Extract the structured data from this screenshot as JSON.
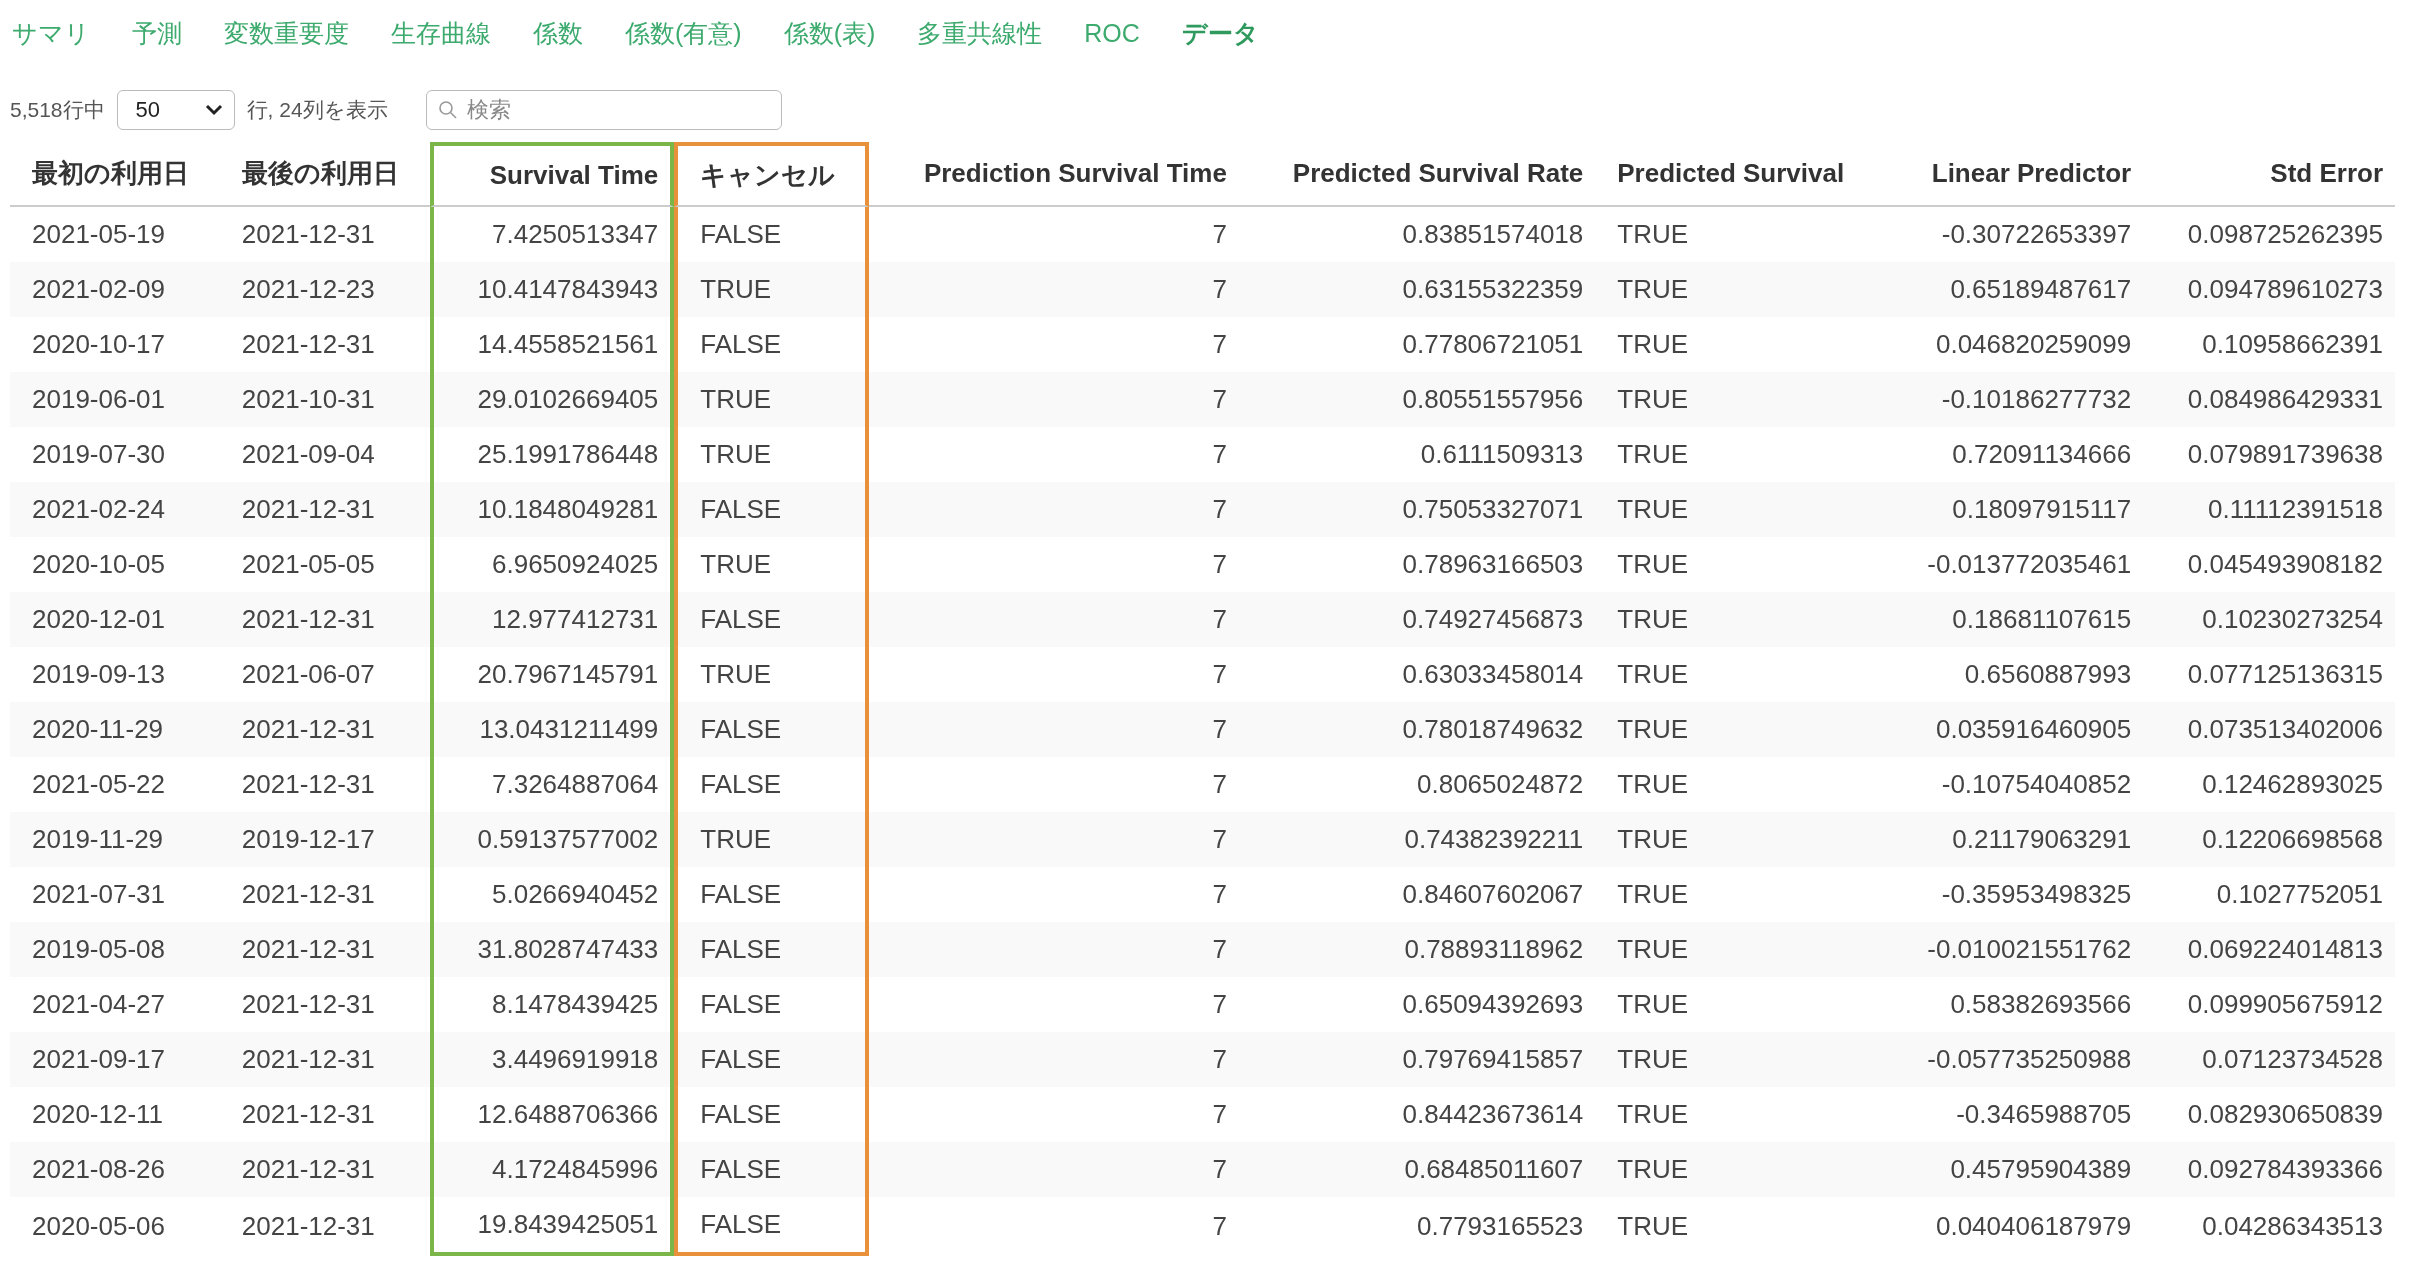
{
  "tabs": [
    {
      "label": "サマリ",
      "selected": false
    },
    {
      "label": "予測",
      "selected": false
    },
    {
      "label": "変数重要度",
      "selected": false
    },
    {
      "label": "生存曲線",
      "selected": false
    },
    {
      "label": "係数",
      "selected": false
    },
    {
      "label": "係数(有意)",
      "selected": false
    },
    {
      "label": "係数(表)",
      "selected": false
    },
    {
      "label": "多重共線性",
      "selected": false
    },
    {
      "label": "ROC",
      "selected": false
    },
    {
      "label": "データ",
      "selected": true
    }
  ],
  "controls": {
    "rows_prefix": "5,518行中",
    "page_size": "50",
    "rows_suffix": "行, 24列を表示",
    "search": {
      "placeholder": "検索"
    }
  },
  "table": {
    "columns": [
      {
        "label": "最初の利用日",
        "kind": "date"
      },
      {
        "label": "最後の利用日",
        "kind": "date"
      },
      {
        "label": "Survival Time",
        "kind": "number",
        "color": "#7ab648"
      },
      {
        "label": "キャンセル",
        "kind": "boolean",
        "color": "#e8913a"
      },
      {
        "label": "Prediction Survival Time",
        "kind": "number"
      },
      {
        "label": "Predicted Survival Rate",
        "kind": "number"
      },
      {
        "label": "Predicted Survival",
        "kind": "boolean"
      },
      {
        "label": "Linear Predictor",
        "kind": "number"
      },
      {
        "label": "Std Error",
        "kind": "number"
      }
    ],
    "rows": [
      [
        "2021-05-19",
        "2021-12-31",
        "7.4250513347",
        "FALSE",
        "7",
        "0.83851574018",
        "TRUE",
        "-0.30722653397",
        "0.098725262395"
      ],
      [
        "2021-02-09",
        "2021-12-23",
        "10.4147843943",
        "TRUE",
        "7",
        "0.63155322359",
        "TRUE",
        "0.65189487617",
        "0.094789610273"
      ],
      [
        "2020-10-17",
        "2021-12-31",
        "14.4558521561",
        "FALSE",
        "7",
        "0.77806721051",
        "TRUE",
        "0.046820259099",
        "0.10958662391"
      ],
      [
        "2019-06-01",
        "2021-10-31",
        "29.0102669405",
        "TRUE",
        "7",
        "0.80551557956",
        "TRUE",
        "-0.10186277732",
        "0.084986429331"
      ],
      [
        "2019-07-30",
        "2021-09-04",
        "25.1991786448",
        "TRUE",
        "7",
        "0.6111509313",
        "TRUE",
        "0.72091134666",
        "0.079891739638"
      ],
      [
        "2021-02-24",
        "2021-12-31",
        "10.1848049281",
        "FALSE",
        "7",
        "0.75053327071",
        "TRUE",
        "0.18097915117",
        "0.11112391518"
      ],
      [
        "2020-10-05",
        "2021-05-05",
        "6.9650924025",
        "TRUE",
        "7",
        "0.78963166503",
        "TRUE",
        "-0.013772035461",
        "0.045493908182"
      ],
      [
        "2020-12-01",
        "2021-12-31",
        "12.977412731",
        "FALSE",
        "7",
        "0.74927456873",
        "TRUE",
        "0.18681107615",
        "0.10230273254"
      ],
      [
        "2019-09-13",
        "2021-06-07",
        "20.7967145791",
        "TRUE",
        "7",
        "0.63033458014",
        "TRUE",
        "0.6560887993",
        "0.077125136315"
      ],
      [
        "2020-11-29",
        "2021-12-31",
        "13.0431211499",
        "FALSE",
        "7",
        "0.78018749632",
        "TRUE",
        "0.035916460905",
        "0.073513402006"
      ],
      [
        "2021-05-22",
        "2021-12-31",
        "7.3264887064",
        "FALSE",
        "7",
        "0.8065024872",
        "TRUE",
        "-0.10754040852",
        "0.12462893025"
      ],
      [
        "2019-11-29",
        "2019-12-17",
        "0.59137577002",
        "TRUE",
        "7",
        "0.74382392211",
        "TRUE",
        "0.21179063291",
        "0.12206698568"
      ],
      [
        "2021-07-31",
        "2021-12-31",
        "5.0266940452",
        "FALSE",
        "7",
        "0.84607602067",
        "TRUE",
        "-0.35953498325",
        "0.1027752051"
      ],
      [
        "2019-05-08",
        "2021-12-31",
        "31.8028747433",
        "FALSE",
        "7",
        "0.78893118962",
        "TRUE",
        "-0.010021551762",
        "0.069224014813"
      ],
      [
        "2021-04-27",
        "2021-12-31",
        "8.1478439425",
        "FALSE",
        "7",
        "0.65094392693",
        "TRUE",
        "0.58382693566",
        "0.099905675912"
      ],
      [
        "2021-09-17",
        "2021-12-31",
        "3.4496919918",
        "FALSE",
        "7",
        "0.79769415857",
        "TRUE",
        "-0.057735250988",
        "0.07123734528"
      ],
      [
        "2020-12-11",
        "2021-12-31",
        "12.6488706366",
        "FALSE",
        "7",
        "0.84423673614",
        "TRUE",
        "-0.3465988705",
        "0.082930650839"
      ],
      [
        "2021-08-26",
        "2021-12-31",
        "4.1724845996",
        "FALSE",
        "7",
        "0.68485011607",
        "TRUE",
        "0.45795904389",
        "0.092784393366"
      ],
      [
        "2020-05-06",
        "2021-12-31",
        "19.8439425051",
        "FALSE",
        "7",
        "0.7793165523",
        "TRUE",
        "0.040406187979",
        "0.04286343513"
      ]
    ]
  }
}
